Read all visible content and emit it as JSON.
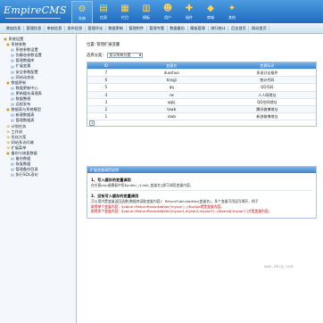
{
  "header": {
    "logo": "EmpireCMS",
    "nav": [
      {
        "label": "系统",
        "icon": "gear-icon",
        "glyph": "⚙",
        "active": true
      },
      {
        "label": "信息",
        "icon": "document-icon",
        "glyph": "▤"
      },
      {
        "label": "栏目",
        "icon": "folder-icon",
        "glyph": "▦"
      },
      {
        "label": "模板",
        "icon": "template-icon",
        "glyph": "▥"
      },
      {
        "label": "用户",
        "icon": "user-icon",
        "glyph": "☻"
      },
      {
        "label": "插件",
        "icon": "plugin-icon",
        "glyph": "✚"
      },
      {
        "label": "商城",
        "icon": "shop-icon",
        "glyph": "◆"
      },
      {
        "label": "其他",
        "icon": "other-icon",
        "glyph": "✦"
      }
    ]
  },
  "subnav": [
    "增加信息",
    "管理信息",
    "审核信息",
    "发布信息",
    "管理评论",
    "数据更新",
    "管理附件",
    "管理专题",
    "数据备份",
    "模板管理",
    "排行统计",
    "后台首页",
    "网站首页"
  ],
  "sidebar": [
    {
      "label": "系统设置",
      "level": 0,
      "glyph": "▣"
    },
    {
      "label": "系统参数",
      "level": 1,
      "glyph": "▣"
    },
    {
      "label": "系统参数设置",
      "level": 2,
      "glyph": "▤"
    },
    {
      "label": "伪静态参数设置",
      "level": 2,
      "glyph": "▤"
    },
    {
      "label": "管理数据库",
      "level": 2,
      "glyph": "▤"
    },
    {
      "label": "扩展变量",
      "level": 2,
      "glyph": "▤"
    },
    {
      "label": "安全参数配置",
      "level": 2,
      "glyph": "▤"
    },
    {
      "label": "网站动态化",
      "level": 2,
      "glyph": "▤"
    },
    {
      "label": "数据更新",
      "level": 1,
      "glyph": "▣"
    },
    {
      "label": "数据更新中心",
      "level": 2,
      "glyph": "▤"
    },
    {
      "label": "更新缓存清理表",
      "level": 2,
      "glyph": "▤"
    },
    {
      "label": "数据整理",
      "level": 2,
      "glyph": "▤"
    },
    {
      "label": "远程发布",
      "level": 2,
      "glyph": "▤"
    },
    {
      "label": "数据表与系统模型",
      "level": 1,
      "glyph": "▣"
    },
    {
      "label": "新建数据表",
      "level": 2,
      "glyph": "▤"
    },
    {
      "label": "管理数据表",
      "level": 2,
      "glyph": "▤"
    },
    {
      "label": "计划任务",
      "level": 1,
      "glyph": "⊞"
    },
    {
      "label": "工作流",
      "level": 1,
      "glyph": "⊞"
    },
    {
      "label": "优化方案",
      "level": 1,
      "glyph": "⊞"
    },
    {
      "label": "网站多访问端",
      "level": 1,
      "glyph": "⊞"
    },
    {
      "label": "扩展菜单",
      "level": 1,
      "glyph": "⊞"
    },
    {
      "label": "备份与恢复数据",
      "level": 1,
      "glyph": "▣"
    },
    {
      "label": "备份数据",
      "level": 2,
      "glyph": "▤"
    },
    {
      "label": "恢复数据",
      "level": 2,
      "glyph": "▤"
    },
    {
      "label": "管理备份目录",
      "level": 2,
      "glyph": "▤"
    },
    {
      "label": "执行SQL语句",
      "level": 2,
      "glyph": "▤"
    }
  ],
  "main": {
    "breadcrumb": "位置: 管理扩展变量",
    "filter_label": "选择分类：",
    "filter_value": "显示所有分类",
    "table": {
      "headers": [
        "ID",
        "变量名",
        "变量标识"
      ],
      "rows": [
        [
          "7",
          "duoshuo",
          "多说讨论插件"
        ],
        [
          "6",
          "tongji",
          "统计代码"
        ],
        [
          "5",
          "qq",
          "QQ号码"
        ],
        [
          "4",
          "rw",
          "人人网地址"
        ],
        [
          "3",
          "qqkj",
          "QQ空间地址"
        ],
        [
          "2",
          "txwb",
          "腾讯微博地址"
        ],
        [
          "1",
          "xlwb",
          "新浪微博地址"
        ]
      ],
      "page": "1"
    },
    "help": {
      "title": "扩展变量调用说明",
      "s1_title": "1、写入缓存的变量调用",
      "s1_line": "在任意php或模板中用$public_r['add_变量名']即可调用变量内容。",
      "s2_title": "2、没有写入缓存的变量调用",
      "s2_line1": "可以用内置变量返回函数(数据库读取变量内容)：ReturnPublicAddVar(变量名)，多个变量可用逗号隔开，例子",
      "s2_line2": "取得单个变量内容：$value=ReturnPublicAddVar('myvar');  //$value就是变量内容。",
      "s2_line3": "取得多个变量内容：$value=ReturnPublicAddVar('myvar1,myvar2,myvar3');  //$value['myvar1']才是变量内容。"
    }
  },
  "watermark": "www.dbsg.com"
}
